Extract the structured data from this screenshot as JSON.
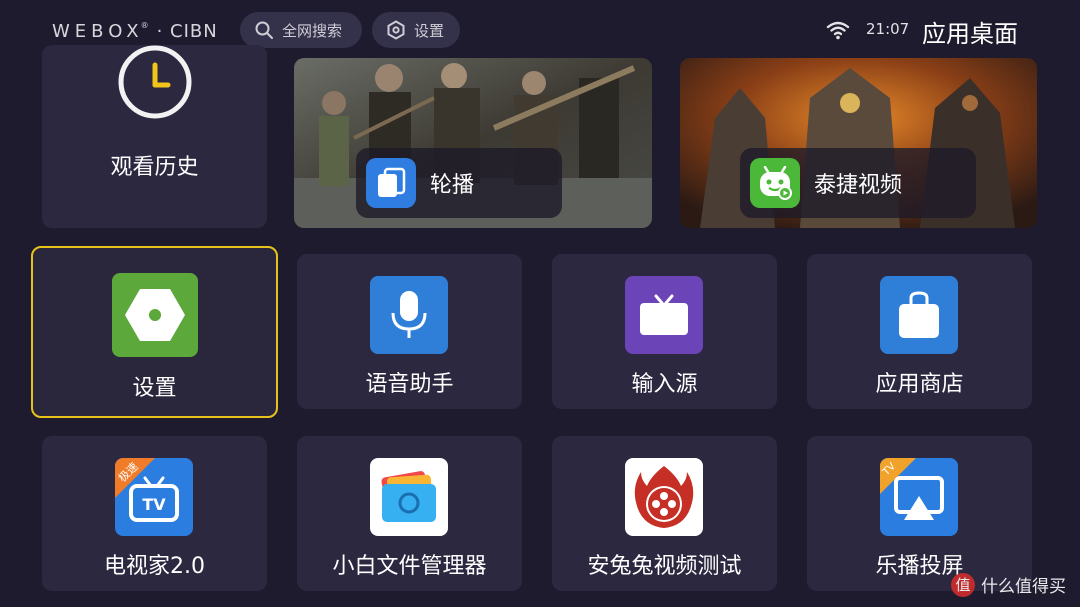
{
  "header": {
    "brand": "WEBOX",
    "brand_mark": "®",
    "brand_suffix": "· CIBN",
    "search_label": "全网搜索",
    "settings_label": "设置",
    "time": "21:07",
    "page_title": "应用桌面"
  },
  "top_row": {
    "history_label": "观看历史",
    "banners": [
      {
        "label": "轮播",
        "icon": "carousel-icon"
      },
      {
        "label": "泰捷视频",
        "icon": "taijie-robot-icon"
      }
    ]
  },
  "apps_row1": [
    {
      "label": "设置",
      "icon": "hexagon-settings-icon",
      "focused": true
    },
    {
      "label": "语音助手",
      "icon": "microphone-icon"
    },
    {
      "label": "输入源",
      "icon": "tv-input-icon"
    },
    {
      "label": "应用商店",
      "icon": "bag-icon"
    }
  ],
  "apps_row2": [
    {
      "label": "电视家2.0",
      "icon": "tvjia-icon",
      "badge": "极速"
    },
    {
      "label": "小白文件管理器",
      "icon": "folder-icon"
    },
    {
      "label": "安兔兔视频测试",
      "icon": "film-reel-icon"
    },
    {
      "label": "乐播投屏",
      "icon": "cast-icon",
      "badge": "TV"
    }
  ],
  "watermark": {
    "glyph": "值",
    "text": "什么值得买"
  },
  "colors": {
    "background": "#1e1b2e",
    "tile": "#2b2840",
    "focus": "#e7c21a"
  }
}
